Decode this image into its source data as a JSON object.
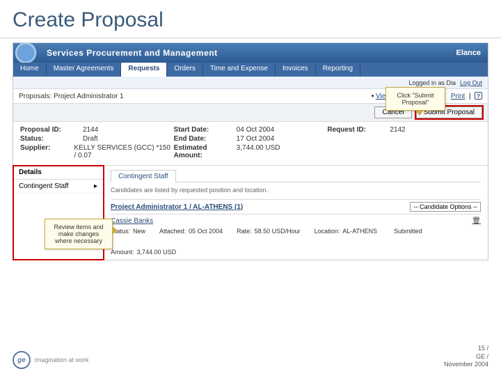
{
  "slide": {
    "title": "Create Proposal"
  },
  "header": {
    "title": "Services Procurement and Management",
    "brand": "Elance"
  },
  "tabs": [
    "Home",
    "Master Agreements",
    "Requests",
    "Orders",
    "Time and Expense",
    "Invoices",
    "Reporting"
  ],
  "active_tab_index": 2,
  "status": {
    "logged_in": "Logged in as Dia",
    "logout": "Log Out"
  },
  "crumb": {
    "path": "Proposals: Project Administrator 1",
    "link": "View original Request",
    "dot": "•"
  },
  "actions": {
    "cancel": "Cancel",
    "submit": "Submit Proposal"
  },
  "info": {
    "left": [
      {
        "k": "Proposal ID:",
        "v": "2144"
      },
      {
        "k": "Status:",
        "v": "Draft"
      },
      {
        "k": "Supplier:",
        "v": "KELLY SERVICES (GCC) *150 / 0.07"
      }
    ],
    "mid": [
      {
        "k": "Start Date:",
        "v": "04 Oct 2004"
      },
      {
        "k": "End Date:",
        "v": "17 Oct 2004"
      },
      {
        "k": "Estimated Amount:",
        "v": "3,744.00 USD"
      }
    ],
    "right": [
      {
        "k": "Request ID:",
        "v": "2142"
      }
    ]
  },
  "side": {
    "header": "Details",
    "item": "Contingent Staff",
    "caret": "▸"
  },
  "sub": {
    "tab": "Contingent Staff",
    "hint": "Candidates are listed by requested position and location."
  },
  "candidate": {
    "title": "Project Administrator 1 / AL-ATHENS (1)",
    "select": "-- Candidate Options --",
    "name": "Cassie Banks",
    "trash_tip": "Delete candidate",
    "rows": [
      {
        "k": "Status:",
        "v": "New"
      },
      {
        "k": "Attached:",
        "v": "05 Oct 2004"
      },
      {
        "k": "Rate:",
        "v": "58.50 USD/Hour"
      },
      {
        "k": "Location:",
        "v": "AL-ATHENS"
      },
      {
        "k": "",
        "v": "Submitted"
      },
      {
        "k": "Amount:",
        "v": "3,744.00 USD"
      }
    ]
  },
  "callouts": {
    "review": "Review items and make changes where necessary",
    "submit": "Click \"Submit Proposal\""
  },
  "print": {
    "label": "Print",
    "icon_tip": "info"
  },
  "footer": {
    "tag": "imagination at work",
    "page": "15 /",
    "org": "GE /",
    "date": "November 2004"
  }
}
